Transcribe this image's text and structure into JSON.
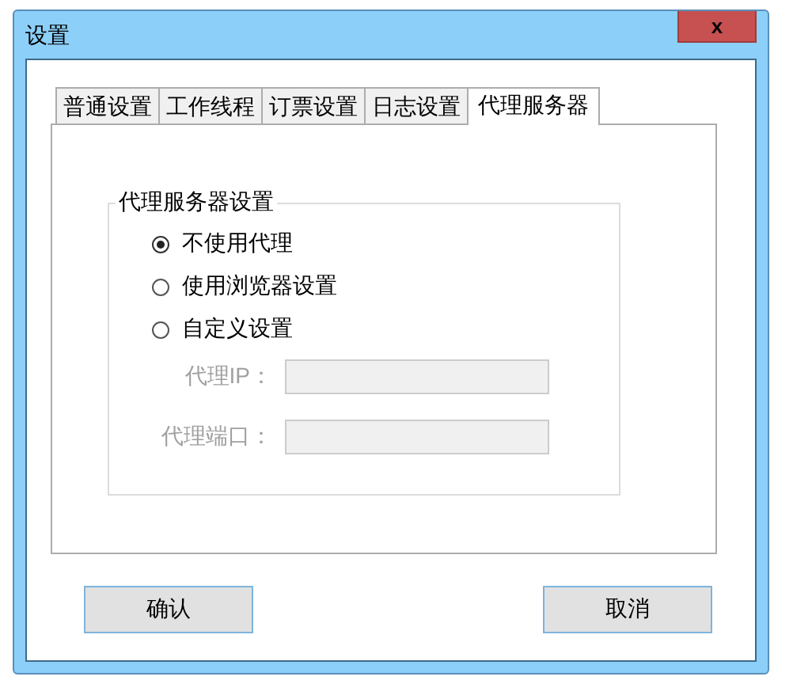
{
  "window": {
    "title": "设置",
    "close": "x"
  },
  "tabs": [
    {
      "label": "普通设置",
      "selected": false
    },
    {
      "label": "工作线程",
      "selected": false
    },
    {
      "label": "订票设置",
      "selected": false
    },
    {
      "label": "日志设置",
      "selected": false
    },
    {
      "label": "代理服务器",
      "selected": true
    }
  ],
  "group": {
    "title": "代理服务器设置",
    "options": [
      {
        "label": "不使用代理",
        "selected": true
      },
      {
        "label": "使用浏览器设置",
        "selected": false
      },
      {
        "label": "自定义设置",
        "selected": false
      }
    ],
    "fields": [
      {
        "label": "代理IP：",
        "disabled": true
      },
      {
        "label": "代理端口：",
        "disabled": true
      }
    ]
  },
  "buttons": [
    "确认",
    "取消"
  ]
}
